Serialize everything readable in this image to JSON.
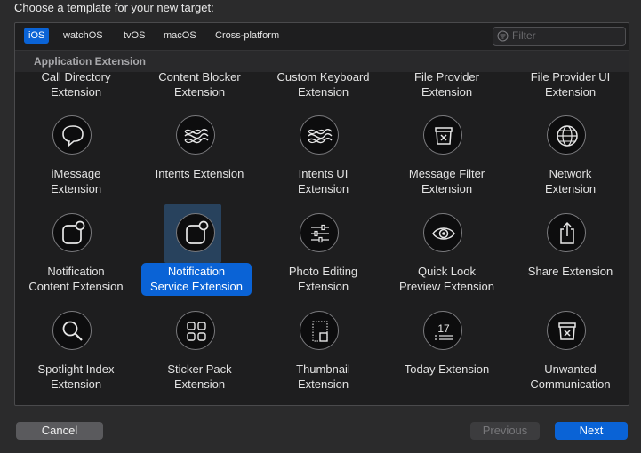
{
  "dialog": {
    "heading": "Choose a template for your new target:"
  },
  "tabs": [
    {
      "label": "iOS",
      "selected": true
    },
    {
      "label": "watchOS",
      "selected": false
    },
    {
      "label": "tvOS",
      "selected": false
    },
    {
      "label": "macOS",
      "selected": false
    },
    {
      "label": "Cross-platform",
      "selected": false
    }
  ],
  "filter": {
    "placeholder": "Filter",
    "value": ""
  },
  "section": {
    "title": "Application Extension"
  },
  "top_row": [
    "Call Directory\nExtension",
    "Content Blocker\nExtension",
    "Custom Keyboard\nExtension",
    "File Provider\nExtension",
    "File Provider UI\nExtension"
  ],
  "templates": [
    {
      "label": "iMessage\nExtension",
      "icon": "speech-bubble-icon"
    },
    {
      "label": "Intents Extension",
      "icon": "waves-icon"
    },
    {
      "label": "Intents UI\nExtension",
      "icon": "waves-icon"
    },
    {
      "label": "Message Filter\nExtension",
      "icon": "filter-box-icon"
    },
    {
      "label": "Network\nExtension",
      "icon": "globe-icon"
    },
    {
      "label": "Notification\nContent Extension",
      "icon": "notification-icon"
    },
    {
      "label": "Notification\nService Extension",
      "icon": "notification-icon",
      "selected": true
    },
    {
      "label": "Photo Editing\nExtension",
      "icon": "sliders-icon"
    },
    {
      "label": "Quick Look\nPreview Extension",
      "icon": "eye-icon"
    },
    {
      "label": "Share Extension",
      "icon": "share-icon"
    },
    {
      "label": "Spotlight Index\nExtension",
      "icon": "magnifier-icon"
    },
    {
      "label": "Sticker Pack\nExtension",
      "icon": "grid-icon"
    },
    {
      "label": "Thumbnail\nExtension",
      "icon": "thumbnail-icon"
    },
    {
      "label": "Today Extension",
      "icon": "calendar-icon",
      "icon_text": "17"
    },
    {
      "label": "Unwanted\nCommunication",
      "icon": "filter-box-icon"
    }
  ],
  "buttons": {
    "cancel": "Cancel",
    "previous": "Previous",
    "next": "Next"
  },
  "colors": {
    "accent": "#0a63d6",
    "background": "#2b2b2c",
    "panel": "#1e1e1f"
  }
}
